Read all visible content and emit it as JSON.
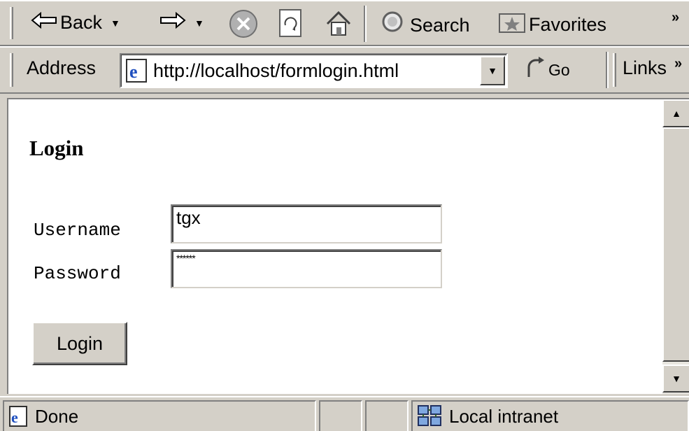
{
  "toolbar": {
    "back_label": "Back",
    "search_label": "Search",
    "favorites_label": "Favorites",
    "chevron": "»"
  },
  "address_bar": {
    "label": "Address",
    "url": "http://localhost/formlogin.html",
    "go_label": "Go",
    "links_label": "Links",
    "chevron": "»"
  },
  "page": {
    "title": "Login",
    "username_label": "Username",
    "username_value": "tgx",
    "password_label": "Password",
    "password_value": "******",
    "login_button": "Login"
  },
  "status_bar": {
    "status_text": "Done",
    "zone_text": "Local intranet"
  },
  "icons": {
    "back": "back-arrow-icon",
    "forward": "forward-arrow-icon",
    "stop": "stop-icon",
    "refresh": "refresh-icon",
    "home": "home-icon",
    "search": "search-icon",
    "favorites": "favorites-icon",
    "page": "ie-page-icon",
    "go": "go-arrow-icon",
    "zone": "local-intranet-icon"
  }
}
